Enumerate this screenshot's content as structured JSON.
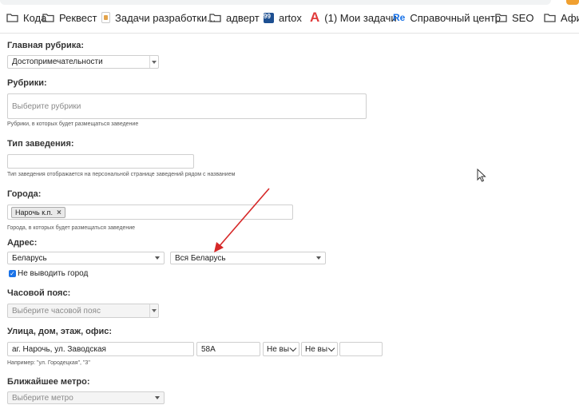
{
  "bookmarks": [
    {
      "label": "Кода",
      "icon": "folder-icon"
    },
    {
      "label": "Реквест",
      "icon": "folder-icon"
    },
    {
      "label": "Задачи разработки...",
      "icon": "document-icon"
    },
    {
      "label": "адверт",
      "icon": "folder-icon"
    },
    {
      "label": "artox",
      "icon": "badge-99-icon",
      "badge": "99"
    },
    {
      "label": "(1) Мои задачи",
      "icon": "red-a-icon",
      "badge": "A"
    },
    {
      "label": "Справочный центр",
      "icon": "re-icon",
      "badge": "Re"
    },
    {
      "label": "SEO",
      "icon": "folder-icon"
    },
    {
      "label": "Афиш",
      "icon": "folder-icon"
    }
  ],
  "form": {
    "main_rubric": {
      "label": "Главная рубрика:",
      "value": "Достопримечательности"
    },
    "rubrics": {
      "label": "Рубрики:",
      "placeholder": "Выберите рубрики",
      "hint": "Рубрики, в которых будет размещаться заведение"
    },
    "venue_type": {
      "label": "Тип заведения:",
      "value": "",
      "hint": "Тип заведения отображается на персональной странице заведений рядом с названием"
    },
    "cities": {
      "label": "Города:",
      "tags": [
        "Нарочь к.п."
      ],
      "hint": "Города, в которых будет размещаться заведение"
    },
    "address": {
      "label": "Адрес:",
      "country": "Беларусь",
      "region": "Вся Беларусь",
      "hide_city_label": "Не выводить город",
      "hide_city_checked": true
    },
    "timezone": {
      "label": "Часовой пояс:",
      "placeholder": "Выберите часовой пояс"
    },
    "street": {
      "label": "Улица, дом, этаж, офис:",
      "street_value": "аг. Нарочь, ул. Заводская",
      "house_value": "58А",
      "floor_value": "Не вы",
      "office_value": "Не вы",
      "extra_value": "",
      "hint": "Например: \"ул. Городецкая\", \"3\""
    },
    "metro": {
      "label": "Ближайшее метро:",
      "placeholder": "Выберите метро"
    }
  },
  "colors": {
    "accent": "#1a73e8",
    "annotation_arrow": "#d62828",
    "tab_accent": "#f0a030"
  }
}
